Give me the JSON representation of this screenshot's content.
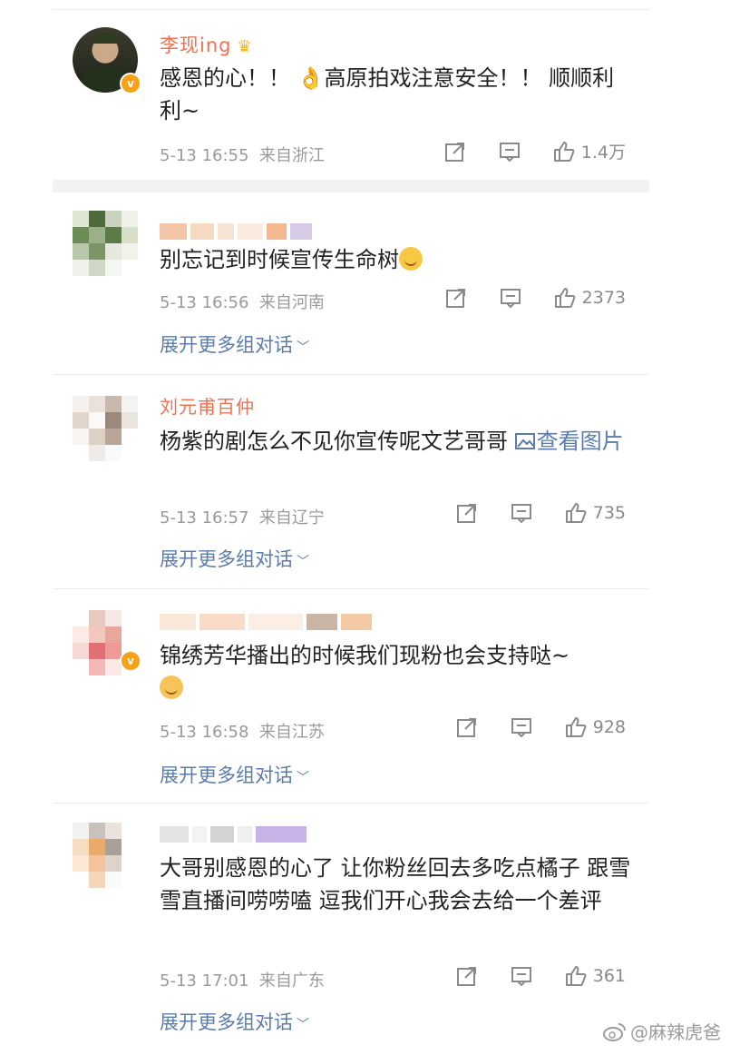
{
  "comments": [
    {
      "name": "李现ing",
      "text": "感恩的心！！ 👌高原拍戏注意安全！！ 顺顺利利~",
      "time": "5-13 16:55",
      "location": "来自浙江",
      "likes": "1.4万"
    },
    {
      "name": "",
      "text": "别忘记到时候宣传生命树",
      "time": "5-13 16:56",
      "location": "来自河南",
      "likes": "2373",
      "expand": "展开更多组对话"
    },
    {
      "name": "刘元甫百仲",
      "text": "杨紫的剧怎么不见你宣传呢文艺哥哥 ",
      "view_image": "查看图片",
      "time": "5-13 16:57",
      "location": "来自辽宁",
      "likes": "735",
      "expand": "展开更多组对话"
    },
    {
      "name": "",
      "text": "锦绣芳华播出的时候我们现粉也会支持哒~",
      "time": "5-13 16:58",
      "location": "来自江苏",
      "likes": "928",
      "expand": "展开更多组对话"
    },
    {
      "name": "",
      "text": "大哥别感恩的心了 让你粉丝回去多吃点橘子 跟雪雪直播间唠唠嗑 逗我们开心我会去给一个差评",
      "time": "5-13 17:01",
      "location": "来自广东",
      "likes": "361",
      "expand": "展开更多组对话"
    }
  ],
  "watermark": "@麻辣虎爸",
  "colors": {
    "name": "#eb7350",
    "link": "#5b7cad",
    "meta": "#9a9a9a"
  },
  "icons": [
    "share-icon",
    "comment-icon",
    "like-icon",
    "verified-badge-icon",
    "weibo-logo-icon"
  ]
}
